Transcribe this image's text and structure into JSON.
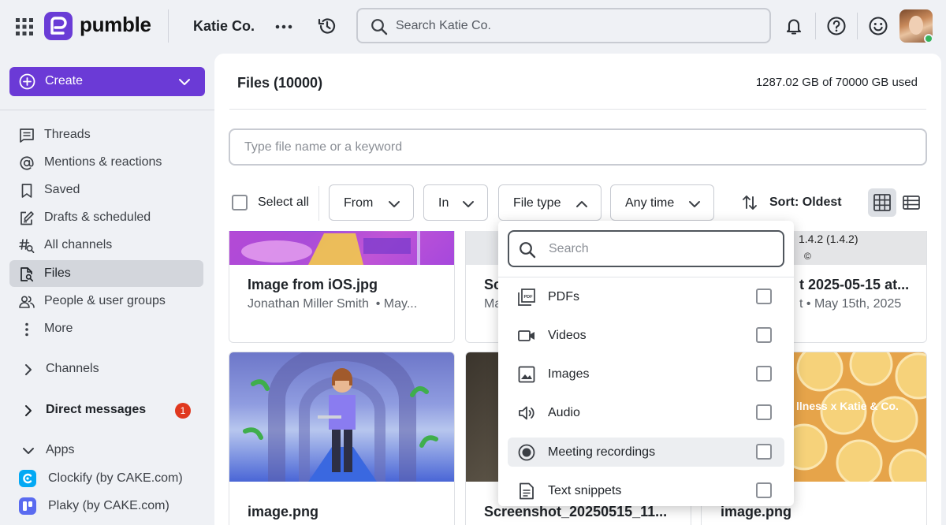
{
  "app": {
    "name": "pumble",
    "workspace": "Katie Co."
  },
  "search": {
    "placeholder": "Search Katie Co."
  },
  "sidebar": {
    "create_label": "Create",
    "nav": [
      {
        "label": "Threads",
        "icon": "threads-icon"
      },
      {
        "label": "Mentions & reactions",
        "icon": "at-icon"
      },
      {
        "label": "Saved",
        "icon": "bookmark-icon"
      },
      {
        "label": "Drafts & scheduled",
        "icon": "drafts-icon"
      },
      {
        "label": "All channels",
        "icon": "channels-search-icon"
      },
      {
        "label": "Files",
        "icon": "file-search-icon",
        "active": true
      },
      {
        "label": "People & user groups",
        "icon": "people-icon"
      },
      {
        "label": "More",
        "icon": "more-vertical-icon"
      }
    ],
    "sections": {
      "channels": "Channels",
      "direct_messages": "Direct messages",
      "direct_messages_badge": "1",
      "apps": "Apps"
    },
    "apps": [
      {
        "label": "Clockify (by CAKE.com)",
        "color": "#03a9f4"
      },
      {
        "label": "Plaky (by CAKE.com)",
        "color": "#5a6bf0"
      }
    ]
  },
  "files": {
    "title": "Files (10000)",
    "storage": "1287.02 GB of 70000 GB used",
    "keyword_placeholder": "Type file name or a keyword",
    "select_all": "Select all",
    "filters": {
      "from": "From",
      "in": "In",
      "file_type": "File type",
      "time": "Any time"
    },
    "sort_label": "Sort: Oldest",
    "cards": [
      {
        "name": "Image from iOS.jpg",
        "meta": "Jonathan Miller Smith",
        "date": "• May..."
      },
      {
        "name": "Sc",
        "meta": "Ma",
        "thumb_text": "1.4.2 (1.4.2)"
      },
      {
        "name": "t 2025-05-15 at...",
        "meta": "t • May 15th, 2025"
      },
      {
        "name": "image.png"
      },
      {
        "name": "Screenshot_20250515_11..."
      },
      {
        "name": "image.png",
        "thumb_text": "llness x Katie & Co."
      }
    ]
  },
  "file_type_dropdown": {
    "search_placeholder": "Search",
    "items": [
      {
        "label": "PDFs",
        "icon": "pdf-icon"
      },
      {
        "label": "Videos",
        "icon": "video-icon"
      },
      {
        "label": "Images",
        "icon": "image-icon"
      },
      {
        "label": "Audio",
        "icon": "audio-icon"
      },
      {
        "label": "Meeting recordings",
        "icon": "record-icon"
      },
      {
        "label": "Text snippets",
        "icon": "text-snippet-icon"
      }
    ]
  },
  "colors": {
    "brand": "#6b3ad6",
    "badge": "#e0381e",
    "online": "#35b35c"
  }
}
